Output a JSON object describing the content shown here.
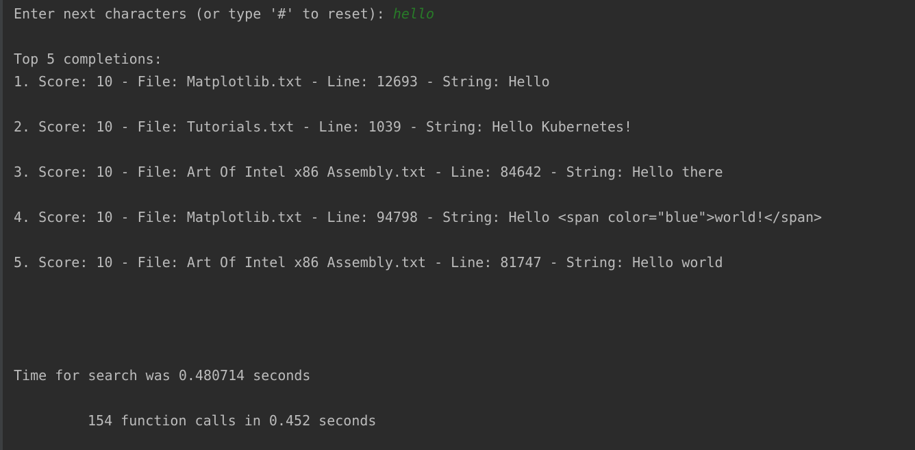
{
  "console": {
    "prompt_text": "Enter next characters (or type '#' to reset): ",
    "user_input": "hello",
    "header": "Top 5 completions:",
    "results": [
      "1. Score: 10 - File: Matplotlib.txt - Line: 12693 - String: Hello",
      "2. Score: 10 - File: Tutorials.txt - Line: 1039 - String: Hello Kubernetes!",
      "3. Score: 10 - File: Art Of Intel x86 Assembly.txt - Line: 84642 - String: Hello there",
      "4. Score: 10 - File: Matplotlib.txt - Line: 94798 - String: Hello <span color=\"blue\">world!</span>",
      "5. Score: 10 - File: Art Of Intel x86 Assembly.txt - Line: 81747 - String: Hello world"
    ],
    "timing_text": "Time for search was 0.480714 seconds",
    "profile_text": "154 function calls in 0.452 seconds"
  },
  "colors": {
    "background": "#2b2b2b",
    "text": "#bbbbbb",
    "user_input": "#287b28"
  }
}
